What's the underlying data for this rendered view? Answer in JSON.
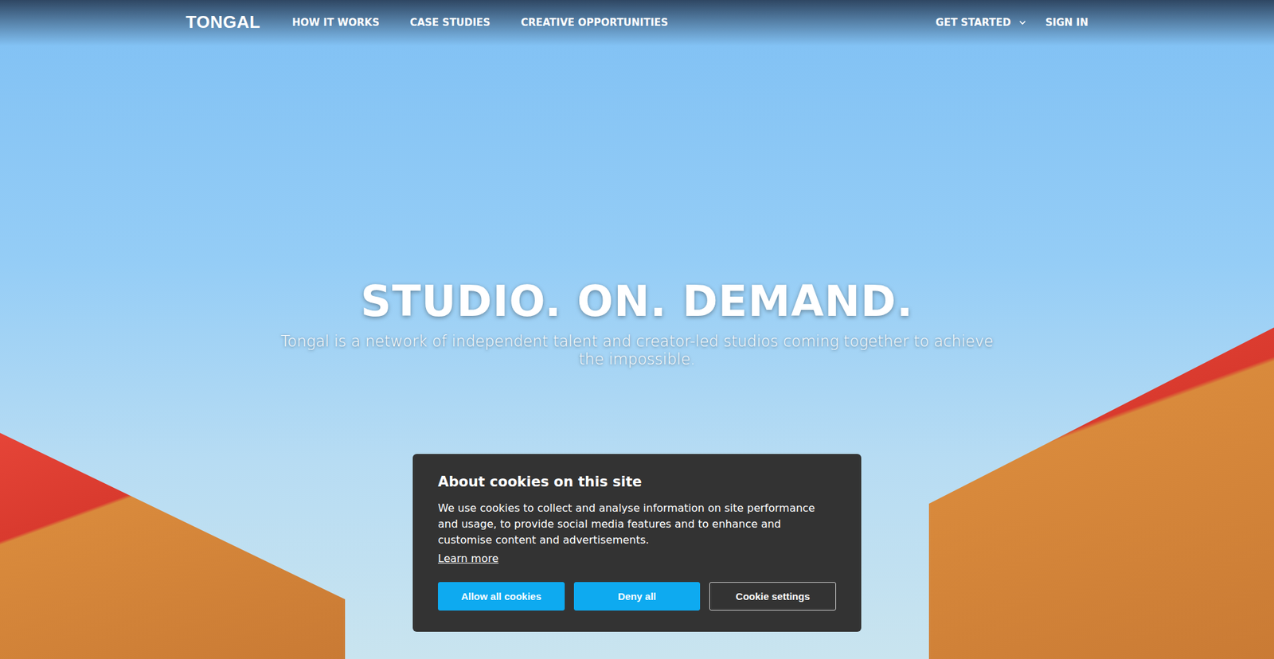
{
  "logo": "TONGAL",
  "nav": {
    "links": [
      "HOW IT WORKS",
      "CASE STUDIES",
      "CREATIVE OPPORTUNITIES"
    ],
    "get_started": "GET STARTED",
    "sign_in": "SIGN IN"
  },
  "hero": {
    "title": "STUDIO. ON. DEMAND.",
    "subtitle": "Tongal is a network of independent talent and creator-led studios coming together to achieve the impossible."
  },
  "cookie_banner": {
    "title": "About cookies on this site",
    "text": "We use cookies to collect and analyse information on site performance and usage, to provide social media features and to enhance and customise content and advertisements.",
    "learn_more": "Learn more",
    "buttons": [
      {
        "label": "Allow all cookies",
        "kind": "primary"
      },
      {
        "label": "Deny all",
        "kind": "primary"
      },
      {
        "label": "Cookie settings",
        "kind": "outline"
      }
    ]
  }
}
